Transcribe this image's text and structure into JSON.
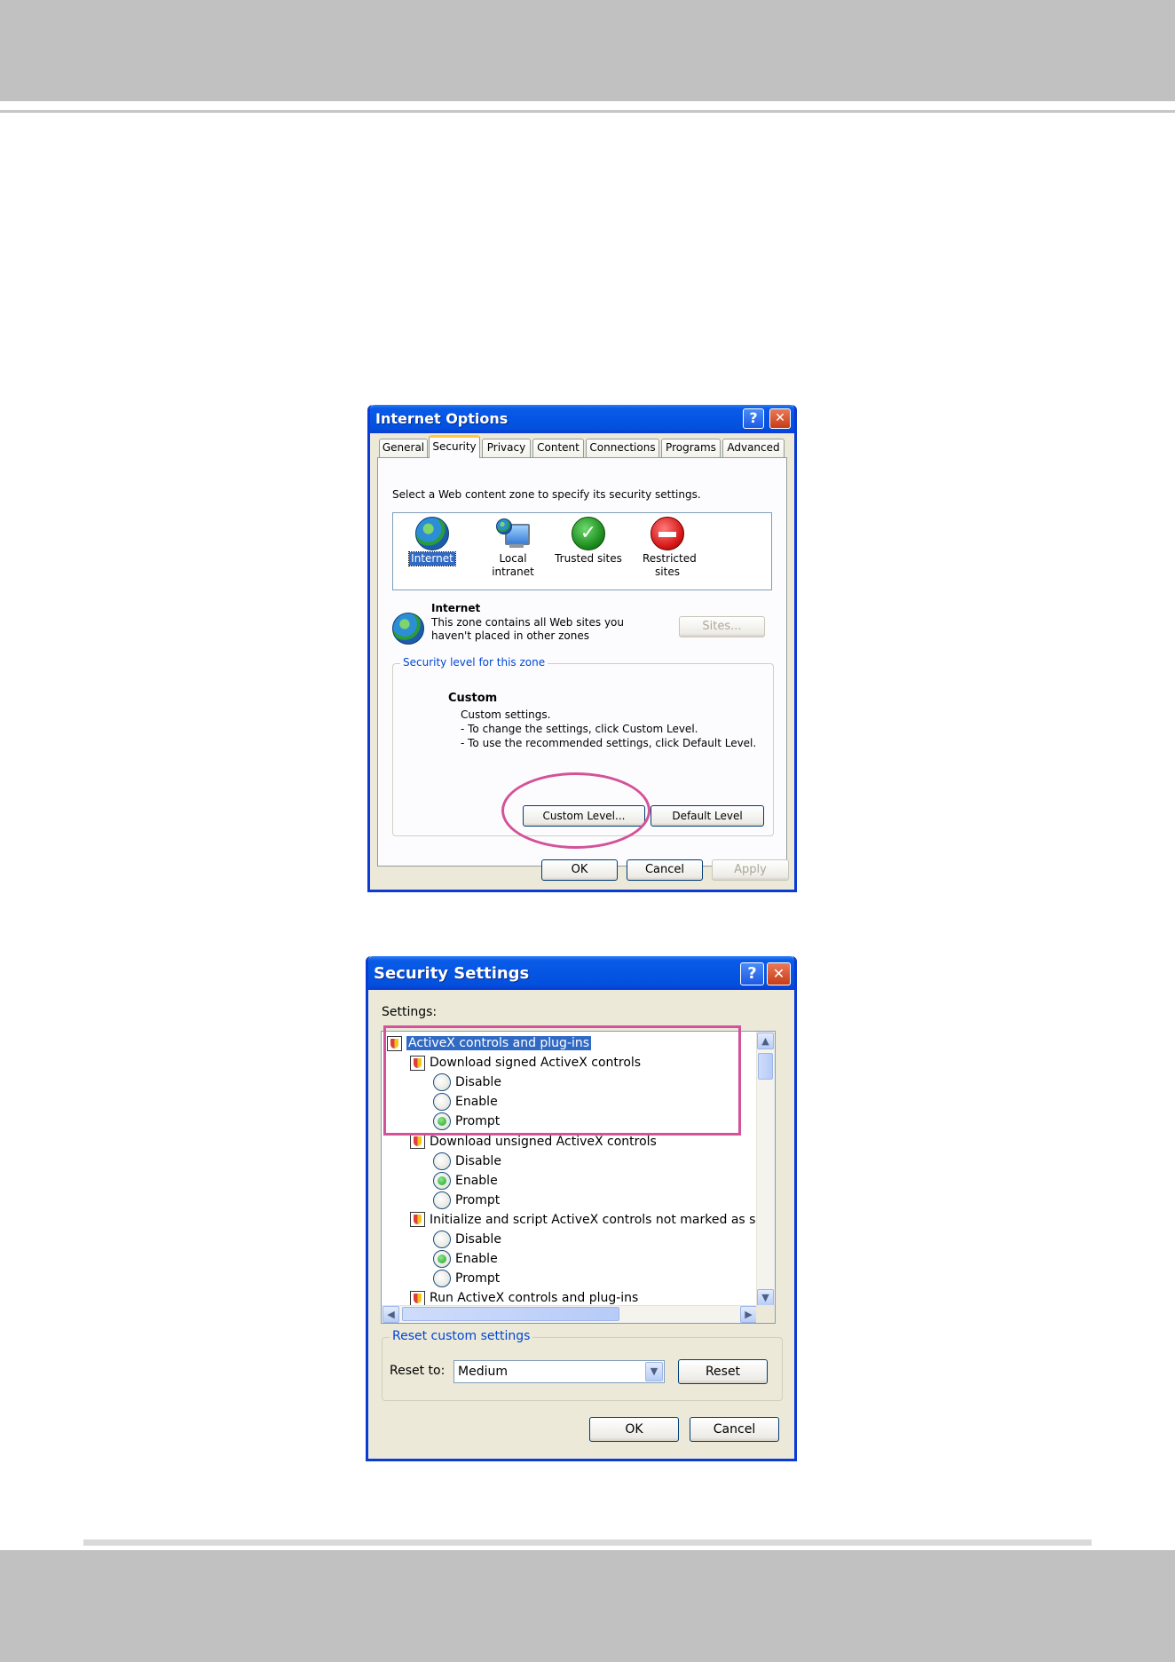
{
  "internet_options": {
    "title": "Internet Options",
    "help": "?",
    "close": "✕",
    "tabs": [
      "General",
      "Security",
      "Privacy",
      "Content",
      "Connections",
      "Programs",
      "Advanced"
    ],
    "zone_prompt": "Select a Web content zone to specify its security settings.",
    "zones": [
      {
        "label": "Internet",
        "icon": "globe-icon"
      },
      {
        "label": "Local intranet",
        "icon": "intranet-icon"
      },
      {
        "label": "Trusted sites",
        "icon": "checkmark-icon"
      },
      {
        "label": "Restricted sites",
        "icon": "no-entry-icon"
      }
    ],
    "zone_title": "Internet",
    "zone_desc_1": "This zone contains all Web sites you",
    "zone_desc_2": "haven't placed in other zones",
    "sites_button": "Sites...",
    "security_level_legend": "Security level for this zone",
    "level_name": "Custom",
    "level_line1": "Custom settings.",
    "level_line2": "- To change the settings, click Custom Level.",
    "level_line3": "- To use the recommended settings, click Default Level.",
    "custom_level_button": "Custom Level...",
    "default_level_button": "Default Level",
    "ok": "OK",
    "cancel": "Cancel",
    "apply": "Apply"
  },
  "security_settings": {
    "title": "Security Settings",
    "help": "?",
    "close": "✕",
    "settings_label": "Settings:",
    "tree": [
      {
        "type": "category",
        "label": "ActiveX controls and plug-ins",
        "indent": 0,
        "selected": true
      },
      {
        "type": "setting",
        "label": "Download signed ActiveX controls",
        "indent": 1
      },
      {
        "type": "option",
        "label": "Disable",
        "indent": 2,
        "checked": false
      },
      {
        "type": "option",
        "label": "Enable",
        "indent": 2,
        "checked": false
      },
      {
        "type": "option",
        "label": "Prompt",
        "indent": 2,
        "checked": true
      },
      {
        "type": "setting",
        "label": "Download unsigned ActiveX controls",
        "indent": 1
      },
      {
        "type": "option",
        "label": "Disable",
        "indent": 2,
        "checked": false
      },
      {
        "type": "option",
        "label": "Enable",
        "indent": 2,
        "checked": true
      },
      {
        "type": "option",
        "label": "Prompt",
        "indent": 2,
        "checked": false
      },
      {
        "type": "setting",
        "label": "Initialize and script ActiveX controls not marked as safe",
        "indent": 1
      },
      {
        "type": "option",
        "label": "Disable",
        "indent": 2,
        "checked": false
      },
      {
        "type": "option",
        "label": "Enable",
        "indent": 2,
        "checked": true
      },
      {
        "type": "option",
        "label": "Prompt",
        "indent": 2,
        "checked": false
      },
      {
        "type": "setting",
        "label": "Run ActiveX controls and plug-ins",
        "indent": 1
      }
    ],
    "scroll_up": "▲",
    "scroll_down": "▼",
    "scroll_left": "◀",
    "scroll_right": "▶",
    "reset_legend": "Reset custom settings",
    "reset_to_label": "Reset to:",
    "reset_to_value": "Medium",
    "dropdown_arrow": "▼",
    "reset_button": "Reset",
    "ok": "OK",
    "cancel": "Cancel"
  },
  "colors": {
    "highlight": "#d4529a",
    "xp_blue": "#0a3bd4"
  }
}
